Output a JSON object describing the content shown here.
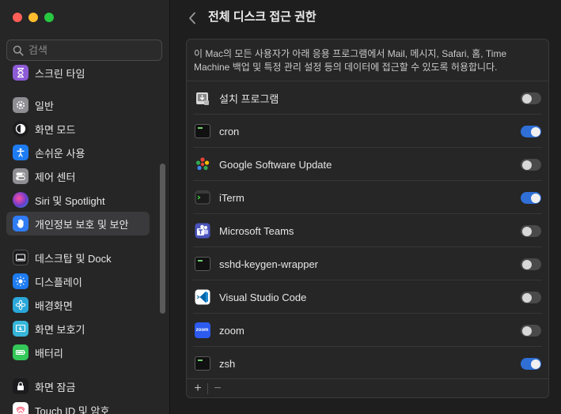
{
  "window": {
    "title": "전체 디스크 접근 권한",
    "traffic_lights": [
      "close",
      "minimize",
      "zoom"
    ]
  },
  "search": {
    "placeholder": "검색",
    "value": ""
  },
  "sidebar": {
    "items": [
      {
        "label": "스크린 타임",
        "icon": "hourglass-icon",
        "color": "#8e5bd6"
      },
      {
        "label": "일반",
        "icon": "gear-icon",
        "color": "#8e8e93"
      },
      {
        "label": "화면 모드",
        "icon": "appearance-icon",
        "color": "#1c1c1e"
      },
      {
        "label": "손쉬운 사용",
        "icon": "accessibility-icon",
        "color": "#1e7cf2"
      },
      {
        "label": "제어 센터",
        "icon": "control-center-icon",
        "color": "#8e8e93"
      },
      {
        "label": "Siri 및 Spotlight",
        "icon": "siri-icon",
        "color": "#6a3cc9"
      },
      {
        "label": "개인정보 보호 및 보안",
        "icon": "hand-icon",
        "color": "#2f7cf6",
        "selected": true
      },
      {
        "label": "데스크탑 및 Dock",
        "icon": "dock-icon",
        "color": "#1c1c1e"
      },
      {
        "label": "디스플레이",
        "icon": "sun-icon",
        "color": "#1e7cf2"
      },
      {
        "label": "배경화면",
        "icon": "flower-icon",
        "color": "#2aa7d9"
      },
      {
        "label": "화면 보호기",
        "icon": "screensaver-icon",
        "color": "#37b6d9"
      },
      {
        "label": "배터리",
        "icon": "battery-icon",
        "color": "#34c759"
      },
      {
        "label": "화면 잠금",
        "icon": "lock-icon",
        "color": "#1c1c1e"
      },
      {
        "label": "Touch ID 및 암호",
        "icon": "fingerprint-icon",
        "color": "#ffffff"
      }
    ]
  },
  "main": {
    "description": "이 Mac의 모든 사용자가 아래 응용 프로그램에서 Mail, 메시지, Safari, 홈, Time Machine 백업 및 특정 관리 설정 등의 데이터에 접근할 수 있도록 허용합니다.",
    "apps": [
      {
        "name": "설치 프로그램",
        "icon": "installer-icon",
        "enabled": false
      },
      {
        "name": "cron",
        "icon": "terminal-icon",
        "enabled": true
      },
      {
        "name": "Google Software Update",
        "icon": "google-update-icon",
        "enabled": false
      },
      {
        "name": "iTerm",
        "icon": "iterm-icon",
        "enabled": true
      },
      {
        "name": "Microsoft Teams",
        "icon": "teams-icon",
        "enabled": false
      },
      {
        "name": "sshd-keygen-wrapper",
        "icon": "terminal-icon",
        "enabled": false
      },
      {
        "name": "Visual Studio Code",
        "icon": "vscode-icon",
        "enabled": false
      },
      {
        "name": "zoom",
        "icon": "zoom-icon",
        "enabled": false,
        "icon_text": "zoom"
      },
      {
        "name": "zsh",
        "icon": "terminal-icon",
        "enabled": true
      }
    ],
    "footer": {
      "add_label": "+",
      "remove_label": "−"
    }
  },
  "colors": {
    "accent": "#2f6fd6",
    "selected_bg": "#3a3a3c"
  }
}
